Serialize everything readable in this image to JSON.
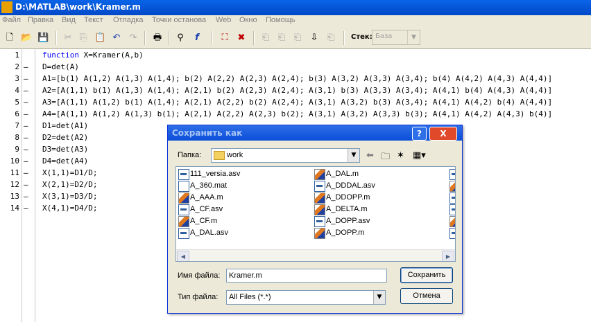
{
  "window": {
    "title": "D:\\MATLAB\\work\\Kramer.m"
  },
  "menu": [
    "Файл",
    "Правка",
    "Вид",
    "Текст",
    "Отладка",
    "Точки останова",
    "Web",
    "Окно",
    "Помощь"
  ],
  "toolbar": {
    "stack_label": "Стек:",
    "stack_value": "База"
  },
  "editor": {
    "line_numbers": [
      "1",
      "2",
      "3",
      "4",
      "5",
      "6",
      "7",
      "8",
      "9",
      "10",
      "11",
      "12",
      "13",
      "14"
    ],
    "dash_marker": "–",
    "line1_keyword": "function",
    "line1_rest": " X=Kramer(A,b)",
    "lines": [
      "D=det(A)",
      "A1=[b(1) A(1,2) A(1,3) A(1,4); b(2) A(2,2) A(2,3) A(2,4); b(3) A(3,2) A(3,3) A(3,4); b(4) A(4,2) A(4,3) A(4,4)]",
      "A2=[A(1,1) b(1) A(1,3) A(1,4); A(2,1) b(2) A(2,3) A(2,4); A(3,1) b(3) A(3,3) A(3,4); A(4,1) b(4) A(4,3) A(4,4)]",
      "A3=[A(1,1) A(1,2) b(1) A(1,4); A(2,1) A(2,2) b(2) A(2,4); A(3,1) A(3,2) b(3) A(3,4); A(4,1) A(4,2) b(4) A(4,4)]",
      "A4=[A(1,1) A(1,2) A(1,3) b(1); A(2,1) A(2,2) A(2,3) b(2); A(3,1) A(3,2) A(3,3) b(3); A(4,1) A(4,2) A(4,3) b(4)]",
      "D1=det(A1)",
      "D2=det(A2)",
      "D3=det(A3)",
      "D4=det(A4)",
      "X(1,1)=D1/D;",
      "X(2,1)=D2/D;",
      "X(3,1)=D3/D;",
      "X(4,1)=D4/D;"
    ]
  },
  "dialog": {
    "title": "Сохранить как",
    "help_label": "?",
    "close_label": "X",
    "folder_label": "Папка:",
    "folder_value": "work",
    "files_col1": [
      "111_versia.asv",
      "A_360.mat",
      "A_AAA.m",
      "A_CF.asv",
      "A_CF.m",
      "A_DAL.asv"
    ],
    "files_col2": [
      "A_DAL.m",
      "A_DDDAL.asv",
      "A_DDOPP.m",
      "A_DELTA.m",
      "A_DOPP.asv",
      "A_DOPP.m"
    ],
    "filename_label": "Имя файла:",
    "filename_value": "Kramer.m",
    "filetype_label": "Тип файла:",
    "filetype_value": "All Files (*.*)",
    "save_label": "Сохранить",
    "cancel_label": "Отмена"
  },
  "colors": {
    "keyword": "#0000ff",
    "title_bar": "#0a64e8",
    "menu_disabled": "#808080"
  }
}
